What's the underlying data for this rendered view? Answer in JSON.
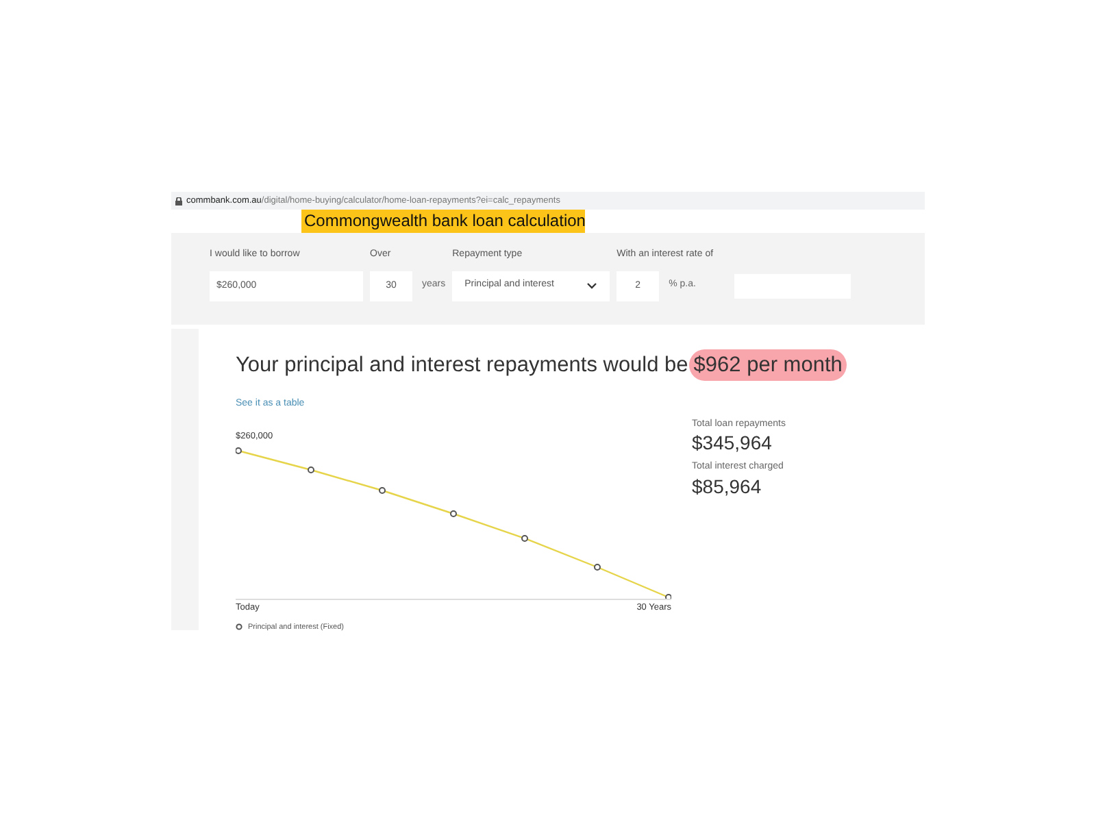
{
  "address_bar": {
    "url_host": "commbank.com.au",
    "url_path": "/digital/home-buying/calculator/home-loan-repayments?ei=calc_repayments"
  },
  "caption": "Commongwealth bank loan calculation",
  "form": {
    "fields": [
      {
        "kind": "text",
        "label": "I would like to borrow",
        "value": "$260,000"
      },
      {
        "kind": "unit",
        "label": "Over",
        "value": "30",
        "unit": "years"
      },
      {
        "kind": "select",
        "label": "Repayment type",
        "value": "Principal and interest"
      },
      {
        "kind": "unit",
        "label": "With an interest rate of",
        "value": "2",
        "unit": "% p.a.",
        "extra_field": true
      }
    ]
  },
  "result": {
    "text": "Your principal and interest repayments would be",
    "highlight": "$962 per month"
  },
  "table_link": "See it as a table",
  "chart": {
    "start_label": "$260,000",
    "x_start": "Today",
    "x_end": "30 Years",
    "legend": "Principal and interest (Fixed)"
  },
  "totals": [
    {
      "label": "Total loan repayments",
      "value": "$345,964"
    },
    {
      "label": "Total interest charged",
      "value": "$85,964"
    }
  ]
}
